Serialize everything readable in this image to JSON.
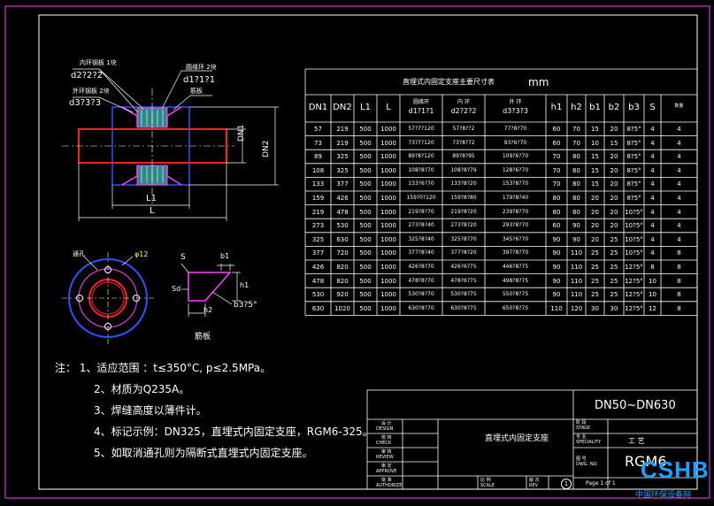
{
  "table": {
    "title": "直埋式内固定支座主要尺寸表",
    "unit": "mm",
    "headers": [
      "DN1",
      "DN2",
      "L1",
      "L",
      "圆缘环 d1?1?1",
      "内 环 d2?2?2",
      "外 环 d3?3?3",
      "h1",
      "h2",
      "b1",
      "b2",
      "b3",
      "S",
      "数量"
    ],
    "rows": [
      [
        "57",
        "219",
        "500",
        "1000",
        "57?7?120",
        "57?8??2",
        "77?8?70",
        "60",
        "70",
        "15",
        "20",
        "8?5°",
        "4",
        "4"
      ],
      [
        "73",
        "219",
        "500",
        "1000",
        "73?7?120",
        "73?8?72",
        "93?6?70",
        "60",
        "70",
        "10",
        "15",
        "8?5°",
        "4",
        "4"
      ],
      [
        "89",
        "325",
        "500",
        "1000",
        "89?8?120",
        "89?8?95",
        "109?6?70",
        "70",
        "80",
        "15",
        "20",
        "8?5°",
        "4",
        "4"
      ],
      [
        "108",
        "325",
        "500",
        "1000",
        "108?8?70",
        "108?8?79",
        "128?6?70",
        "70",
        "80",
        "15",
        "20",
        "8?5°",
        "4",
        "4"
      ],
      [
        "133",
        "377",
        "500",
        "1000",
        "133?6?70",
        "133?8?20",
        "153?8?70",
        "70",
        "80",
        "15",
        "20",
        "8?5°",
        "4",
        "4"
      ],
      [
        "159",
        "426",
        "500",
        "1000",
        "159?0?120",
        "159?8?80",
        "179?8?40",
        "80",
        "80",
        "20",
        "20",
        "8?5°",
        "4",
        "4"
      ],
      [
        "219",
        "478",
        "500",
        "1000",
        "219?8?70",
        "219?8?20",
        "239?8?70",
        "80",
        "80",
        "20",
        "20",
        "10?5°",
        "4",
        "4"
      ],
      [
        "273",
        "530",
        "500",
        "1000",
        "273?8?40",
        "273?8?20",
        "293?8?70",
        "60",
        "90",
        "20",
        "20",
        "10?5°",
        "4",
        "4"
      ],
      [
        "325",
        "630",
        "500",
        "1000",
        "325?8?40",
        "325?8?70",
        "345?6?70",
        "90",
        "90",
        "20",
        "25",
        "10?5°",
        "4",
        "4"
      ],
      [
        "377",
        "720",
        "500",
        "1000",
        "377?8?40",
        "377?8?20",
        "397?8?70",
        "90",
        "110",
        "25",
        "25",
        "10?5°",
        "4",
        "8"
      ],
      [
        "426",
        "820",
        "500",
        "1000",
        "426?8?70",
        "426?6?75",
        "446?8?75",
        "90",
        "110",
        "25",
        "25",
        "12?5°",
        "8",
        "8"
      ],
      [
        "478",
        "820",
        "500",
        "1000",
        "478?8?70",
        "478?6?75",
        "498?8?75",
        "90",
        "110",
        "25",
        "25",
        "12?5°",
        "10",
        "8"
      ],
      [
        "530",
        "920",
        "500",
        "1000",
        "530?8?70",
        "530?8?75",
        "550?8?75",
        "90",
        "110",
        "25",
        "25",
        "12?5°",
        "10",
        "8"
      ],
      [
        "630",
        "1020",
        "500",
        "1000",
        "630?8?70",
        "630?8?75",
        "650?8?75",
        "110",
        "120",
        "30",
        "30",
        "12?5°",
        "12",
        "8"
      ]
    ]
  },
  "drawing": {
    "callouts": [
      "内环钢板 1块",
      "d2?2?2",
      "外环钢板 2块",
      "d3?3?3",
      "圆缘环 2块",
      "d1?1?1",
      "筋板"
    ],
    "dims": {
      "dn1": "DN1",
      "dn2": "DN2",
      "l1": "L1",
      "l": "L"
    },
    "section_labels": {
      "hole": "通孔",
      "phi": "φ12"
    },
    "plate_labels": {
      "s": "S",
      "b1": "b1",
      "h1": "h1",
      "h2": "h2",
      "sd": "Sd",
      "b3": "b3?5°",
      "title": "筋板"
    }
  },
  "notes": [
    "注：  1、适应范围  ：t≤350°C,    p≤2.5MPa。",
    "2、材质为Q235A。",
    "3、焊缝高度以薄件计。",
    "4、标记示例：DN325，直埋式内固定支座，RGM6-325。",
    "5、如取消通孔则为隔断式直埋式内固定支座。"
  ],
  "title_block": {
    "range": "DN50~DN630",
    "name": "直埋式内固定支座",
    "code": "RGM6",
    "specialty": "工 艺",
    "page": "Page  1  of  1",
    "left_labels": [
      {
        "cn": "设 计",
        "en": "DESIGN"
      },
      {
        "cn": "校 核",
        "en": "CHECK"
      },
      {
        "cn": "审 核",
        "en": "REVIEW"
      },
      {
        "cn": "审 定",
        "en": "APPROVE"
      },
      {
        "cn": "批 准",
        "en": "AUTHORIZE"
      }
    ],
    "stage": {
      "cn": "阶 段",
      "en": "STAGE"
    },
    "speciality": {
      "cn": "专 业",
      "en": "SPECIALITY"
    },
    "dwg": {
      "cn": "图 号",
      "en": "DWG. NO."
    },
    "scale": {
      "cn": "比 例",
      "en": "SCALE"
    },
    "rev": {
      "cn": "版 次",
      "en": "REV"
    },
    "rev_mark": "1"
  },
  "watermark": {
    "logo": "CSHB",
    "text": "中国环保设备网"
  }
}
